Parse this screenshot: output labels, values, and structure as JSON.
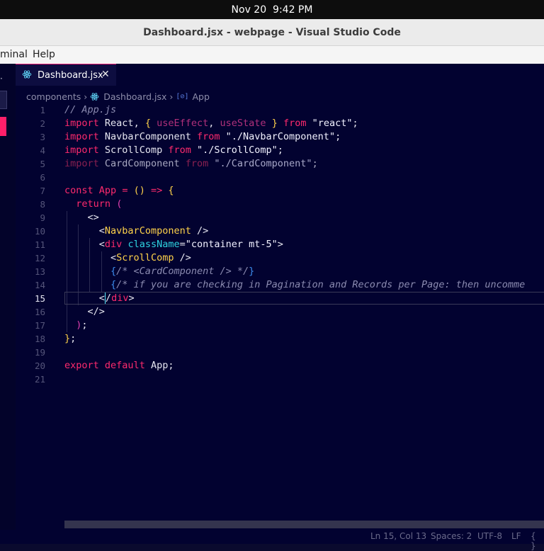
{
  "system": {
    "date": "Nov 20",
    "time": "9:42 PM"
  },
  "window": {
    "title": "Dashboard.jsx - webpage - Visual Studio Code"
  },
  "menu": {
    "items": [
      "minal",
      "Help"
    ]
  },
  "sidebar": {
    "overflow": "·"
  },
  "tab": {
    "label": "Dashboard.jsx",
    "close": "✕",
    "icon": "react-icon"
  },
  "breadcrumb": {
    "folder": "components",
    "file": "Dashboard.jsx",
    "symbol_glyph": "[⊘]",
    "symbol": "App"
  },
  "editor": {
    "active_line": 15,
    "line_numbers": [
      "1",
      "2",
      "3",
      "4",
      "5",
      "6",
      "7",
      "8",
      "9",
      "10",
      "11",
      "12",
      "13",
      "14",
      "15",
      "16",
      "17",
      "18",
      "19",
      "20",
      "21"
    ],
    "lines": [
      "// App.js",
      "import React, { useEffect, useState } from \"react\";",
      "import NavbarComponent from \"./NavbarComponent\";",
      "import ScrollComp from \"./ScrollComp\";",
      "import CardComponent from \"./CardComponent\";",
      "",
      "const App = () => {",
      "  return (",
      "    <>",
      "      <NavbarComponent />",
      "      <div className=\"container mt-5\">",
      "        <ScrollComp />",
      "        {/* <CardComponent /> */}",
      "        {/* if you are checking in Pagination and Records per Page: then uncomme",
      "      </div>",
      "    </>",
      "  );",
      "};",
      "",
      "export default App;",
      ""
    ]
  },
  "status": {
    "position": "Ln 15, Col 13",
    "spaces": "Spaces: 2",
    "encoding": "UTF-8",
    "eol": "LF",
    "language": "{ }"
  },
  "colors": {
    "background": "#020230",
    "keyword": "#ff2a6d",
    "tag": "#ffd24a",
    "attribute": "#2ed3e0",
    "accent": "#e6196f"
  }
}
